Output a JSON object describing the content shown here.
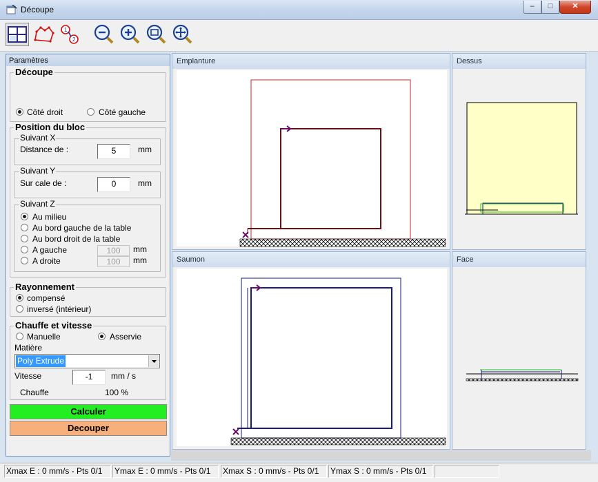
{
  "window": {
    "title": "Découpe",
    "minimize_glyph": "–",
    "maximize_glyph": "□",
    "close_glyph": "✕"
  },
  "toolbar": {
    "buttons": [
      "layout-grid-icon",
      "cut-path-icon",
      "point-link-icon",
      "zoom-out-icon",
      "zoom-in-icon",
      "zoom-fit-icon",
      "zoom-pan-icon"
    ]
  },
  "params": {
    "title": "Paramètres",
    "decoupe": {
      "legend": "Découpe",
      "side_right": "Côté droit",
      "side_left": "Côté gauche",
      "selected": "right"
    },
    "position": {
      "legend": "Position du bloc",
      "x": {
        "legend": "Suivant X",
        "label": "Distance de :",
        "value": "5",
        "unit": "mm"
      },
      "y": {
        "legend": "Suivant Y",
        "label": "Sur cale de :",
        "value": "0",
        "unit": "mm"
      },
      "z": {
        "legend": "Suivant Z",
        "opt_middle": "Au milieu",
        "opt_left_edge": "Au bord gauche de la table",
        "opt_right_edge": "Au bord droit de la table",
        "opt_left": "A gauche",
        "opt_right": "A droite",
        "left_value": "100",
        "right_value": "100",
        "unit": "mm",
        "selected": "middle"
      }
    },
    "rayonnement": {
      "legend": "Rayonnement",
      "opt_comp": "compensé",
      "opt_inv": "inversé (intérieur)",
      "selected": "comp"
    },
    "chauffe": {
      "legend": "Chauffe et vitesse",
      "opt_manual": "Manuelle",
      "opt_auto": "Asservie",
      "selected": "auto",
      "matiere_label": "Matière",
      "matiere_value": "Poly Extrude",
      "vitesse_label": "Vitesse",
      "vitesse_value": "-1",
      "vitesse_unit": "mm / s",
      "chauffe_label": "Chauffe",
      "chauffe_value": "100 %"
    },
    "calc_button": "Calculer",
    "cut_button": "Decouper"
  },
  "views": {
    "emplanture": "Emplanture",
    "dessus": "Dessus",
    "saumon": "Saumon",
    "face": "Face"
  },
  "colors": {
    "calc_bg": "#22ee22",
    "cut_bg": "#f7b07c",
    "profile_dark_red": "#6a0f12",
    "frame_red": "#d02020",
    "profile_navy": "#1a1a7a",
    "purple_mark": "#6a0a6a",
    "top_fill": "#ffffc8"
  },
  "status": [
    "Xmax E : 0 mm/s - Pts 0/1",
    "Ymax E : 0 mm/s - Pts 0/1",
    "Xmax S : 0 mm/s - Pts 0/1",
    "Ymax S : 0 mm/s - Pts 0/1"
  ]
}
